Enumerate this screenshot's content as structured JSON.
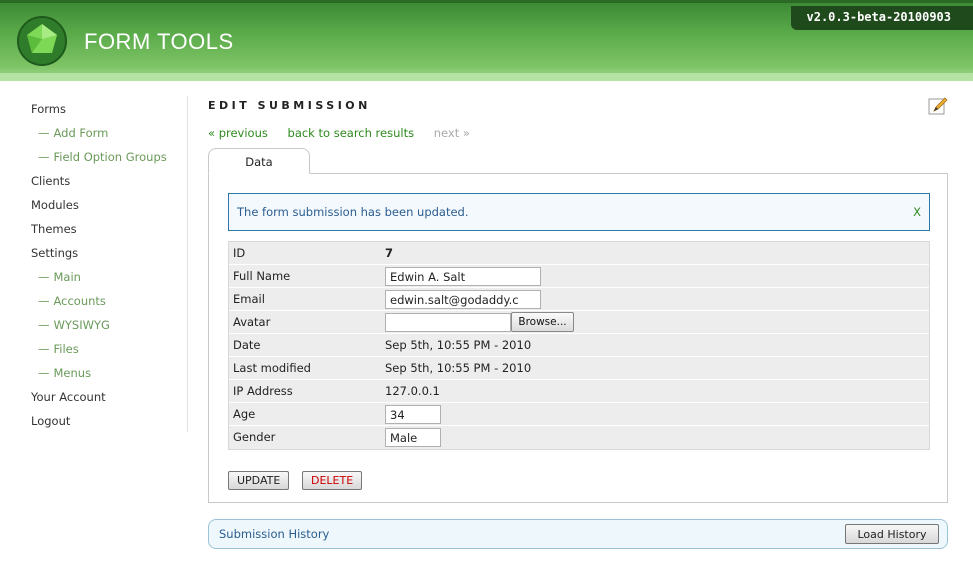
{
  "app": {
    "name": "FORM TOOLS",
    "version": "v2.0.3-beta-20100903"
  },
  "sidebar": {
    "items": [
      {
        "label": "Forms",
        "sub": false
      },
      {
        "label": "Add Form",
        "sub": true
      },
      {
        "label": "Field Option Groups",
        "sub": true
      },
      {
        "label": "Clients",
        "sub": false
      },
      {
        "label": "Modules",
        "sub": false
      },
      {
        "label": "Themes",
        "sub": false
      },
      {
        "label": "Settings",
        "sub": false
      },
      {
        "label": "Main",
        "sub": true
      },
      {
        "label": "Accounts",
        "sub": true
      },
      {
        "label": "WYSIWYG",
        "sub": true
      },
      {
        "label": "Files",
        "sub": true
      },
      {
        "label": "Menus",
        "sub": true
      },
      {
        "label": "Your Account",
        "sub": false
      },
      {
        "label": "Logout",
        "sub": false
      }
    ],
    "sub_dash": "—"
  },
  "main": {
    "title": "EDIT SUBMISSION",
    "pager": {
      "previous": "« previous",
      "back": "back to search results",
      "next": "next »"
    },
    "tab_label": "Data",
    "notice": {
      "text": "The form submission has been updated.",
      "close": "X"
    },
    "fields": {
      "id": {
        "label": "ID",
        "value": "7"
      },
      "full_name": {
        "label": "Full Name",
        "value": "Edwin A. Salt"
      },
      "email": {
        "label": "Email",
        "value": "edwin.salt@godaddy.c"
      },
      "avatar": {
        "label": "Avatar",
        "value": "",
        "browse": "Browse..."
      },
      "date": {
        "label": "Date",
        "value": "Sep 5th, 10:55 PM - 2010"
      },
      "last_modified": {
        "label": "Last modified",
        "value": "Sep 5th, 10:55 PM - 2010"
      },
      "ip": {
        "label": "IP Address",
        "value": "127.0.0.1"
      },
      "age": {
        "label": "Age",
        "value": "34"
      },
      "gender": {
        "label": "Gender",
        "value": "Male"
      }
    },
    "buttons": {
      "update": "UPDATE",
      "delete": "DELETE"
    },
    "history": {
      "label": "Submission History",
      "load": "Load History"
    }
  },
  "colors": {
    "brand_green": "#5aaa4a",
    "link_green": "#2e8a1e",
    "notice_blue": "#2b78a8",
    "delete_red": "#cc0000"
  }
}
